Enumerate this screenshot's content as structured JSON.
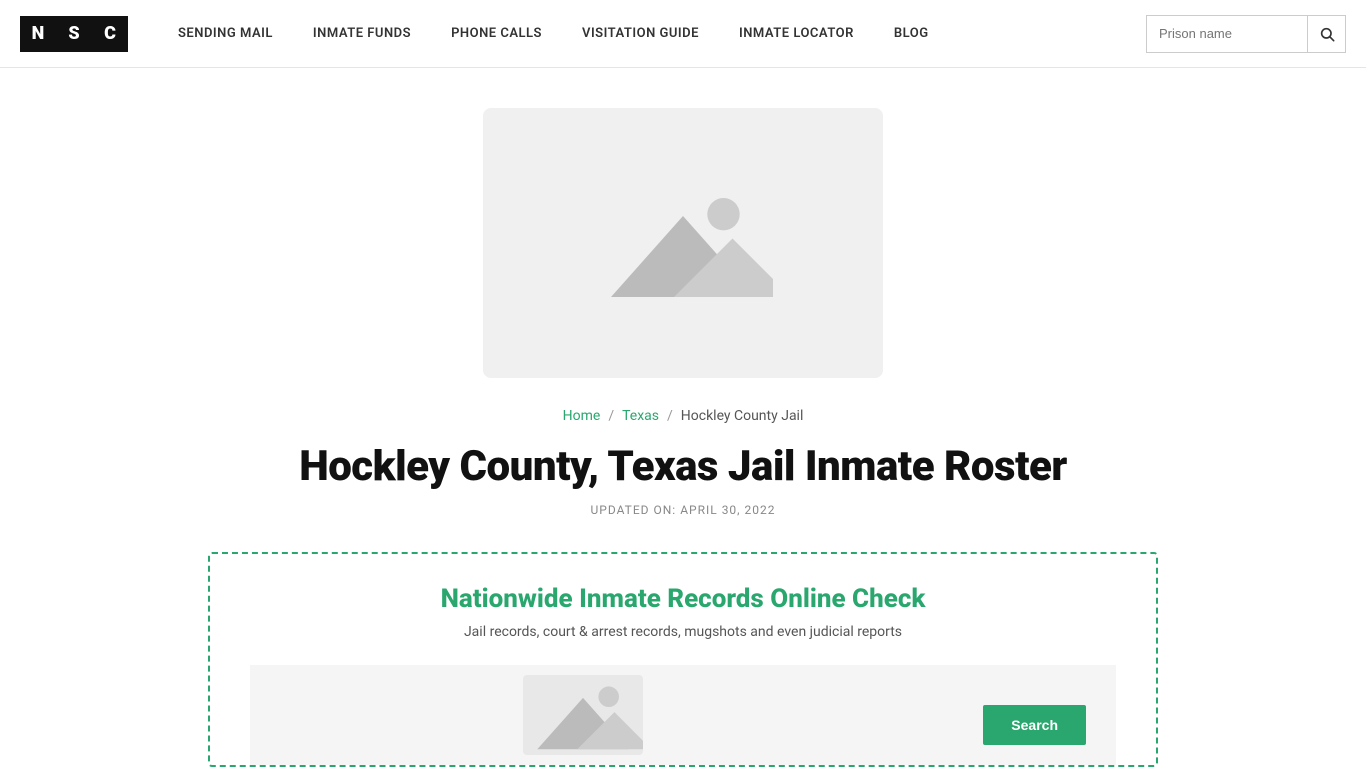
{
  "header": {
    "logo": {
      "letters": [
        "N",
        "S",
        "C"
      ]
    },
    "nav": {
      "items": [
        {
          "label": "SENDING MAIL",
          "href": "#"
        },
        {
          "label": "INMATE FUNDS",
          "href": "#"
        },
        {
          "label": "PHONE CALLS",
          "href": "#"
        },
        {
          "label": "VISITATION GUIDE",
          "href": "#"
        },
        {
          "label": "INMATE LOCATOR",
          "href": "#"
        },
        {
          "label": "BLOG",
          "href": "#"
        }
      ]
    },
    "search": {
      "placeholder": "Prison name",
      "button_icon": "🔍"
    }
  },
  "main": {
    "breadcrumb": {
      "home": "Home",
      "separator1": "/",
      "state": "Texas",
      "separator2": "/",
      "current": "Hockley County Jail"
    },
    "page_title": "Hockley County, Texas Jail Inmate Roster",
    "updated_label": "UPDATED ON: APRIL 30, 2022",
    "records_box": {
      "title": "Nationwide Inmate Records Online Check",
      "subtitle": "Jail records, court & arrest records, mugshots and even judicial reports",
      "search_button": "Search"
    }
  },
  "colors": {
    "green": "#2aa76e",
    "black": "#111111",
    "light_gray": "#f0f0f0"
  }
}
